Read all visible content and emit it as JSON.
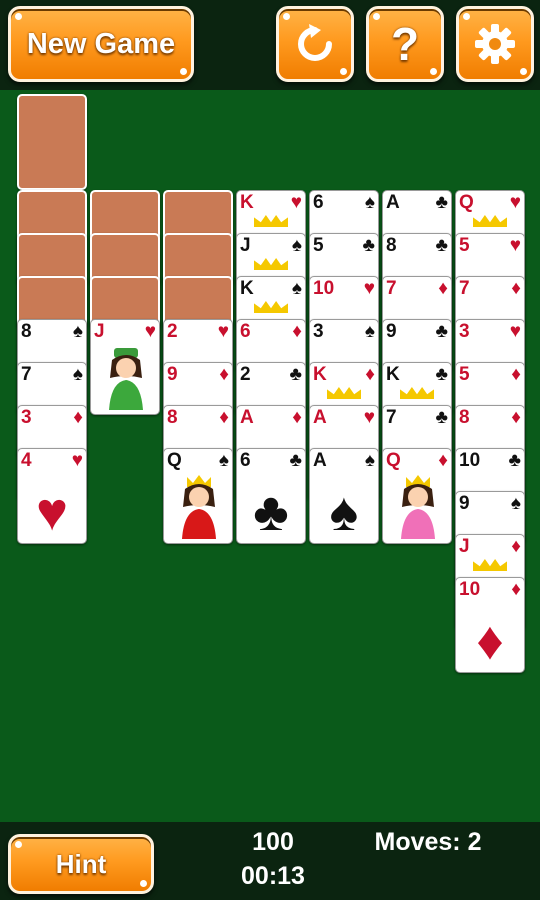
{
  "toolbar": {
    "new_game_label": "New Game",
    "restart_icon": "restart-icon",
    "help_icon": "help-icon",
    "help_glyph": "?",
    "settings_icon": "gear-icon"
  },
  "footer": {
    "hint_label": "Hint",
    "score": "100",
    "time": "00:13",
    "moves": "Moves: 2"
  },
  "colors": {
    "felt": "#0a5a1a",
    "button": "#ff9a1f",
    "card_back": "#c97a55",
    "red_suit": "#c8102e"
  },
  "stock": {
    "count": 1
  },
  "tableau": [
    {
      "face_down": 3,
      "face_up": [
        {
          "rank": "8",
          "suit": "♠",
          "color": "black"
        },
        {
          "rank": "7",
          "suit": "♠",
          "color": "black"
        },
        {
          "rank": "3",
          "suit": "♦",
          "color": "red"
        },
        {
          "rank": "4",
          "suit": "♥",
          "color": "red"
        }
      ]
    },
    {
      "face_down": 3,
      "face_up": [
        {
          "rank": "J",
          "suit": "♥",
          "color": "red"
        }
      ]
    },
    {
      "face_down": 3,
      "face_up": [
        {
          "rank": "2",
          "suit": "♥",
          "color": "red"
        },
        {
          "rank": "9",
          "suit": "♦",
          "color": "red"
        },
        {
          "rank": "8",
          "suit": "♦",
          "color": "red"
        },
        {
          "rank": "Q",
          "suit": "♠",
          "color": "black"
        }
      ]
    },
    {
      "face_down": 0,
      "face_up": [
        {
          "rank": "K",
          "suit": "♥",
          "color": "red"
        },
        {
          "rank": "J",
          "suit": "♠",
          "color": "black"
        },
        {
          "rank": "K",
          "suit": "♠",
          "color": "black"
        },
        {
          "rank": "6",
          "suit": "♦",
          "color": "red"
        },
        {
          "rank": "2",
          "suit": "♣",
          "color": "black"
        },
        {
          "rank": "A",
          "suit": "♦",
          "color": "red"
        },
        {
          "rank": "6",
          "suit": "♣",
          "color": "black"
        }
      ]
    },
    {
      "face_down": 0,
      "face_up": [
        {
          "rank": "6",
          "suit": "♠",
          "color": "black"
        },
        {
          "rank": "5",
          "suit": "♣",
          "color": "black"
        },
        {
          "rank": "10",
          "suit": "♥",
          "color": "red"
        },
        {
          "rank": "3",
          "suit": "♠",
          "color": "black"
        },
        {
          "rank": "K",
          "suit": "♦",
          "color": "red"
        },
        {
          "rank": "A",
          "suit": "♥",
          "color": "red"
        },
        {
          "rank": "A",
          "suit": "♠",
          "color": "black"
        }
      ]
    },
    {
      "face_down": 0,
      "face_up": [
        {
          "rank": "A",
          "suit": "♣",
          "color": "black"
        },
        {
          "rank": "8",
          "suit": "♣",
          "color": "black"
        },
        {
          "rank": "7",
          "suit": "♦",
          "color": "red"
        },
        {
          "rank": "9",
          "suit": "♣",
          "color": "black"
        },
        {
          "rank": "K",
          "suit": "♣",
          "color": "black"
        },
        {
          "rank": "7",
          "suit": "♣",
          "color": "black"
        },
        {
          "rank": "Q",
          "suit": "♦",
          "color": "red"
        }
      ]
    },
    {
      "face_down": 0,
      "face_up": [
        {
          "rank": "Q",
          "suit": "♥",
          "color": "red"
        },
        {
          "rank": "5",
          "suit": "♥",
          "color": "red"
        },
        {
          "rank": "7",
          "suit": "♦",
          "color": "red"
        },
        {
          "rank": "3",
          "suit": "♥",
          "color": "red"
        },
        {
          "rank": "5",
          "suit": "♦",
          "color": "red"
        },
        {
          "rank": "8",
          "suit": "♦",
          "color": "red"
        },
        {
          "rank": "10",
          "suit": "♣",
          "color": "black"
        },
        {
          "rank": "9",
          "suit": "♠",
          "color": "black"
        },
        {
          "rank": "J",
          "suit": "♦",
          "color": "red"
        },
        {
          "rank": "10",
          "suit": "♦",
          "color": "red"
        }
      ]
    }
  ]
}
